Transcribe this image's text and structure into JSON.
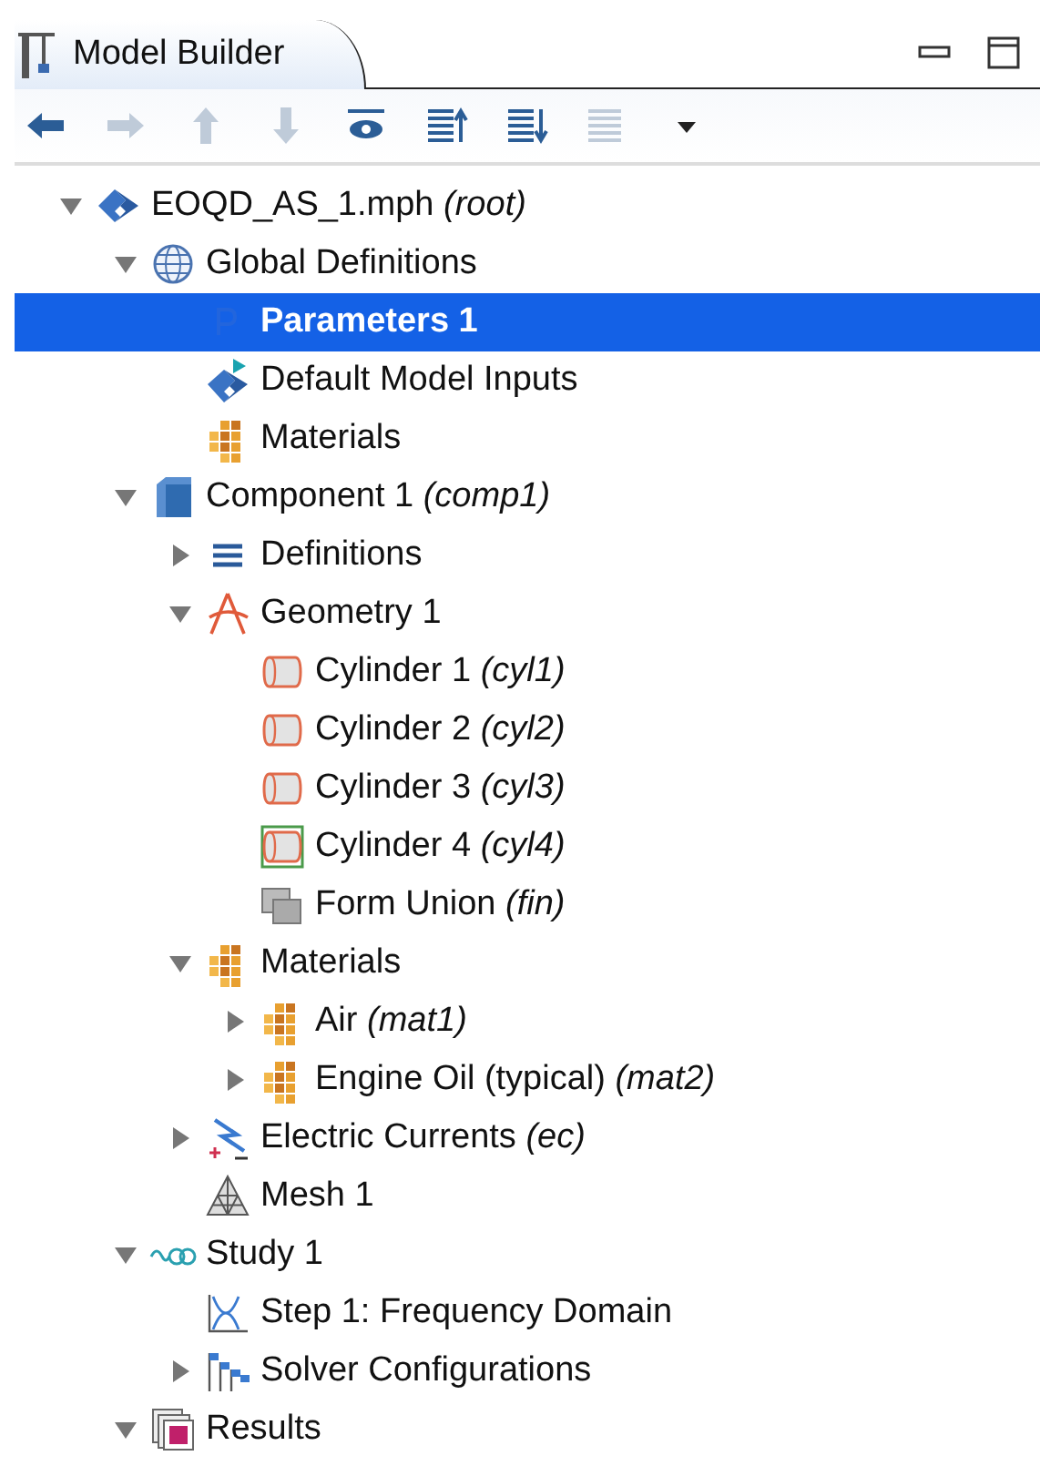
{
  "tab": {
    "title": "Model Builder"
  },
  "toolbar": [
    {
      "kind": "back",
      "disabled": false
    },
    {
      "kind": "forward",
      "disabled": true
    },
    {
      "kind": "up",
      "disabled": true
    },
    {
      "kind": "down",
      "disabled": true
    },
    {
      "kind": "show",
      "disabled": false
    },
    {
      "kind": "collapse",
      "disabled": false
    },
    {
      "kind": "expand",
      "disabled": false
    },
    {
      "kind": "list",
      "disabled": true
    },
    {
      "kind": "dropdown",
      "disabled": false
    }
  ],
  "tree": {
    "items": [
      {
        "label": "EOQD_AS_1.mph *(root)*",
        "kind": "model",
        "expanded": true,
        "selected": false,
        "children": [
          {
            "label": "Global Definitions",
            "kind": "globe",
            "expanded": true,
            "selected": false,
            "children": [
              {
                "label": "Parameters 1",
                "kind": "parameters",
                "selected": true
              },
              {
                "label": "Default Model Inputs",
                "kind": "inputs",
                "selected": false
              },
              {
                "label": "Materials",
                "kind": "materials",
                "selected": false
              }
            ]
          },
          {
            "label": "Component 1 *(comp1)*",
            "kind": "component",
            "expanded": true,
            "selected": false,
            "children": [
              {
                "label": "Definitions",
                "kind": "definitions",
                "expanded": false,
                "selected": false
              },
              {
                "label": "Geometry 1",
                "kind": "geometry",
                "expanded": true,
                "selected": false,
                "children": [
                  {
                    "label": "Cylinder 1 *(cyl1)*",
                    "kind": "cylinder",
                    "selected": false
                  },
                  {
                    "label": "Cylinder 2 *(cyl2)*",
                    "kind": "cylinder",
                    "selected": false
                  },
                  {
                    "label": "Cylinder 3 *(cyl3)*",
                    "kind": "cylinder",
                    "selected": false
                  },
                  {
                    "label": "Cylinder 4 *(cyl4)*",
                    "kind": "cylinder-framed",
                    "selected": false
                  },
                  {
                    "label": "Form Union *(fin)*",
                    "kind": "union",
                    "selected": false
                  }
                ]
              },
              {
                "label": "Materials",
                "kind": "materials",
                "expanded": true,
                "selected": false,
                "children": [
                  {
                    "label": "Air *(mat1)*",
                    "kind": "materials",
                    "expanded": false,
                    "selected": false
                  },
                  {
                    "label": "Engine Oil (typical) *(mat2)*",
                    "kind": "materials",
                    "expanded": false,
                    "selected": false
                  }
                ]
              },
              {
                "label": "Electric Currents *(ec)*",
                "kind": "physics",
                "expanded": false,
                "selected": false
              },
              {
                "label": "Mesh 1",
                "kind": "mesh",
                "selected": false
              }
            ]
          },
          {
            "label": "Study 1",
            "kind": "study",
            "expanded": true,
            "selected": false,
            "children": [
              {
                "label": "Step 1: Frequency Domain",
                "kind": "step",
                "selected": false
              },
              {
                "label": "Solver Configurations",
                "kind": "solver",
                "expanded": false,
                "selected": false
              }
            ]
          },
          {
            "label": "Results",
            "kind": "results",
            "expanded": true,
            "selected": false
          }
        ]
      }
    ]
  }
}
